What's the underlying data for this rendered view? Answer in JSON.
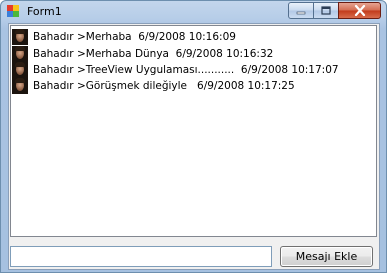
{
  "window": {
    "title": "Form1"
  },
  "messages": [
    {
      "text": "Bahadır >Merhaba  6/9/2008 10:16:09"
    },
    {
      "text": "Bahadır >Merhaba Dünya  6/9/2008 10:16:32"
    },
    {
      "text": "Bahadır >TreeView Uygulaması...........  6/9/2008 10:17:07"
    },
    {
      "text": "Bahadır >Görüşmek dileğiyle   6/9/2008 10:17:25"
    }
  ],
  "input": {
    "value": ""
  },
  "send_button": {
    "label": "Mesajı Ekle"
  }
}
